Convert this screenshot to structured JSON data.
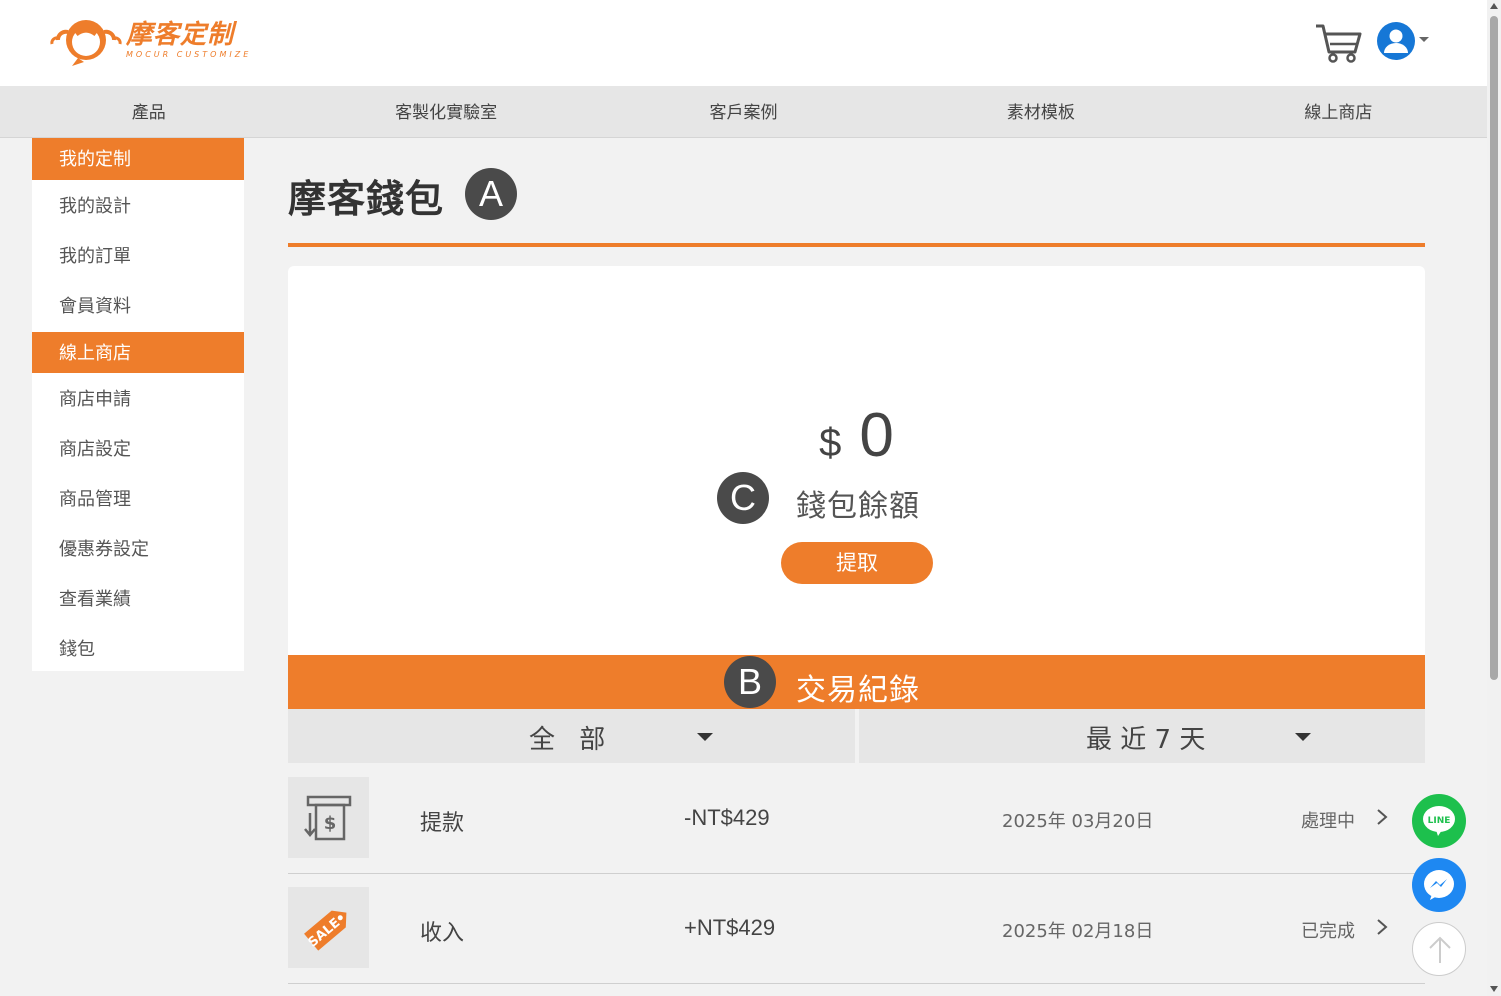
{
  "header": {
    "logo_cn": "摩客定制",
    "logo_en": "MOCUR CUSTOMIZE",
    "cart_icon": "cart-icon",
    "avatar_icon": "user-avatar-icon"
  },
  "nav": {
    "items": [
      "產品",
      "客製化實驗室",
      "客戶案例",
      "素材模板",
      "線上商店"
    ]
  },
  "sidebar": {
    "section1": "我的定制",
    "section1_items": [
      "我的設計",
      "我的訂單",
      "會員資料"
    ],
    "section2": "線上商店",
    "section2_items": [
      "商店申請",
      "商店設定",
      "商品管理",
      "優惠券設定",
      "查看業績",
      "錢包"
    ]
  },
  "main": {
    "title": "摩客錢包",
    "badges": {
      "a": "A",
      "b": "B",
      "c": "C"
    },
    "currency_symbol": "$",
    "balance": "0",
    "balance_label": "錢包餘額",
    "withdraw_label": "提取",
    "transactions_title": "交易紀錄",
    "filter_type": "全 部",
    "filter_period": "最 近 7 天"
  },
  "transactions": [
    {
      "icon": "withdraw-cash-icon",
      "type": "提款",
      "amount": "-NT$429",
      "date": "2025年 03月20日",
      "status": "處理中"
    },
    {
      "icon": "sale-tag-icon",
      "type": "收入",
      "amount": "+NT$429",
      "date": "2025年 02月18日",
      "status": "已完成"
    }
  ],
  "colors": {
    "accent": "#ee7d2b",
    "badge": "#4a4a4a",
    "line": "#1dc04d",
    "messenger": "#1e88f2"
  },
  "floating": {
    "line_label": "LINE"
  }
}
